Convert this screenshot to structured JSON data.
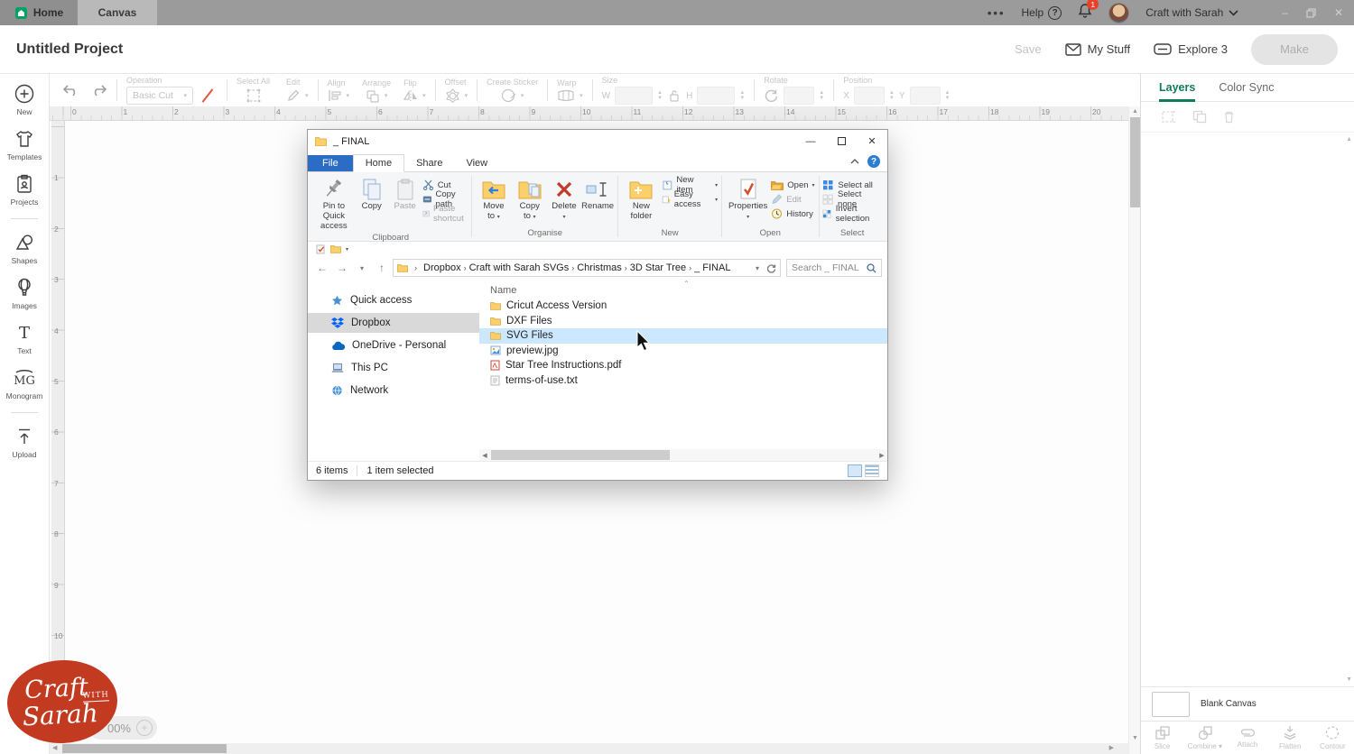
{
  "topbar": {
    "home_label": "Home",
    "canvas_label": "Canvas",
    "overflow_dots": "•••",
    "help_label": "Help",
    "help_glyph": "?",
    "notification_count": "1",
    "account_name": "Craft with Sarah",
    "win_minimize": "–",
    "win_close": "✕"
  },
  "header": {
    "project_title": "Untitled Project",
    "save_label": "Save",
    "my_stuff_label": "My Stuff",
    "explore_label": "Explore 3",
    "make_label": "Make"
  },
  "toolbar": {
    "operation_label": "Operation",
    "operation_value": "Basic Cut",
    "select_all_label": "Select All",
    "edit_label": "Edit",
    "align_label": "Align",
    "arrange_label": "Arrange",
    "flip_label": "Flip",
    "offset_label": "Offset",
    "create_sticker_label": "Create Sticker",
    "warp_label": "Warp",
    "size_label": "Size",
    "w_label": "W",
    "h_label": "H",
    "rotate_label": "Rotate",
    "position_label": "Position",
    "x_label": "X",
    "y_label": "Y"
  },
  "sidebar": {
    "items": [
      {
        "label": "New",
        "icon": "new"
      },
      {
        "label": "Templates",
        "icon": "templates"
      },
      {
        "label": "Projects",
        "icon": "projects"
      },
      {
        "label": "Shapes",
        "icon": "shapes"
      },
      {
        "label": "Images",
        "icon": "images"
      },
      {
        "label": "Text",
        "icon": "text"
      },
      {
        "label": "Monogram",
        "icon": "monogram"
      },
      {
        "label": "Upload",
        "icon": "upload"
      }
    ],
    "divider_after": [
      2,
      6
    ]
  },
  "rulers": {
    "top": [
      "0",
      "1",
      "2",
      "3",
      "4",
      "5",
      "6",
      "7",
      "8",
      "9",
      "10",
      "11",
      "12",
      "13",
      "14",
      "15",
      "16",
      "17",
      "18",
      "19",
      "20"
    ],
    "left": [
      "1",
      "2",
      "3",
      "4",
      "5",
      "6",
      "7",
      "8",
      "9",
      "10"
    ]
  },
  "zoom_control": {
    "value": "00%",
    "plus_glyph": "+"
  },
  "logo": {
    "word1": "Craft",
    "word2": "WITH",
    "word3": "Sarah",
    "color": "#c23a20"
  },
  "explorer": {
    "window_title": "_ FINAL",
    "menu_tabs": [
      "File",
      "Home",
      "Share",
      "View"
    ],
    "ribbon": {
      "groups": [
        {
          "name": "Clipboard",
          "big": [
            {
              "label": "Pin to Quick access",
              "icon": "pin"
            },
            {
              "label": "Copy",
              "icon": "copy"
            },
            {
              "label": "Paste",
              "icon": "paste",
              "disabled": true
            }
          ],
          "small": [
            {
              "label": "Cut",
              "icon": "cut"
            },
            {
              "label": "Copy path",
              "icon": "copypath"
            },
            {
              "label": "Paste shortcut",
              "icon": "shortcut",
              "disabled": true
            }
          ]
        },
        {
          "name": "Organise",
          "big": [
            {
              "label": "Move to",
              "icon": "moveto",
              "dd": true
            },
            {
              "label": "Copy to",
              "icon": "copyto",
              "dd": true
            },
            {
              "label": "Delete",
              "icon": "delete",
              "dd": true
            },
            {
              "label": "Rename",
              "icon": "rename"
            }
          ],
          "small": []
        },
        {
          "name": "New",
          "big": [
            {
              "label": "New folder",
              "icon": "newfolder"
            }
          ],
          "small": [
            {
              "label": "New item",
              "icon": "newitem",
              "dd": true
            },
            {
              "label": "Easy access",
              "icon": "easyaccess",
              "dd": true
            }
          ]
        },
        {
          "name": "Open",
          "big": [
            {
              "label": "Properties",
              "icon": "properties",
              "dd": true
            }
          ],
          "small": [
            {
              "label": "Open",
              "icon": "open",
              "dd": true
            },
            {
              "label": "Edit",
              "icon": "edit",
              "disabled": true
            },
            {
              "label": "History",
              "icon": "history"
            }
          ]
        },
        {
          "name": "Select",
          "big": [],
          "small": [
            {
              "label": "Select all",
              "icon": "selectall"
            },
            {
              "label": "Select none",
              "icon": "selectnone"
            },
            {
              "label": "Invert selection",
              "icon": "invert"
            }
          ]
        }
      ]
    },
    "address": {
      "crumbs": [
        "Dropbox",
        "Craft with Sarah SVGs",
        "Christmas",
        "3D Star Tree",
        "_ FINAL"
      ],
      "search_text": "Search _ FINAL"
    },
    "nav_items": [
      {
        "label": "Quick access",
        "icon": "star"
      },
      {
        "label": "Dropbox",
        "icon": "dropbox",
        "selected": true
      },
      {
        "label": "OneDrive - Personal",
        "icon": "onedrive"
      },
      {
        "label": "This PC",
        "icon": "pc"
      },
      {
        "label": "Network",
        "icon": "network"
      }
    ],
    "list": {
      "column_header": "Name",
      "items": [
        {
          "name": "Cricut Access Version",
          "icon": "folder"
        },
        {
          "name": "DXF Files",
          "icon": "folder"
        },
        {
          "name": "SVG Files",
          "icon": "folder",
          "selected": true
        },
        {
          "name": "preview.jpg",
          "icon": "image"
        },
        {
          "name": "Star Tree Instructions.pdf",
          "icon": "pdf"
        },
        {
          "name": "terms-of-use.txt",
          "icon": "txt"
        }
      ]
    },
    "status": {
      "count": "6 items",
      "selection": "1 item selected"
    }
  },
  "right_panel": {
    "tabs": [
      {
        "label": "Layers",
        "active": true
      },
      {
        "label": "Color Sync"
      }
    ],
    "blank_canvas_label": "Blank Canvas",
    "actions": [
      {
        "label": "Slice",
        "icon": "slice"
      },
      {
        "label": "Combine",
        "icon": "combine",
        "dd": true
      },
      {
        "label": "Attach",
        "icon": "attach"
      },
      {
        "label": "Flatten",
        "icon": "flatten"
      },
      {
        "label": "Contour",
        "icon": "contour"
      }
    ]
  },
  "colors": {
    "cricut_green": "#00a265",
    "layers_green": "#0f7b5a",
    "badge_red": "#e8402a",
    "logo_red": "#c23a20",
    "selection_blue": "#cce8ff",
    "file_tab_blue": "#2b6cc4",
    "folder_yellow": "#fbd06b"
  }
}
